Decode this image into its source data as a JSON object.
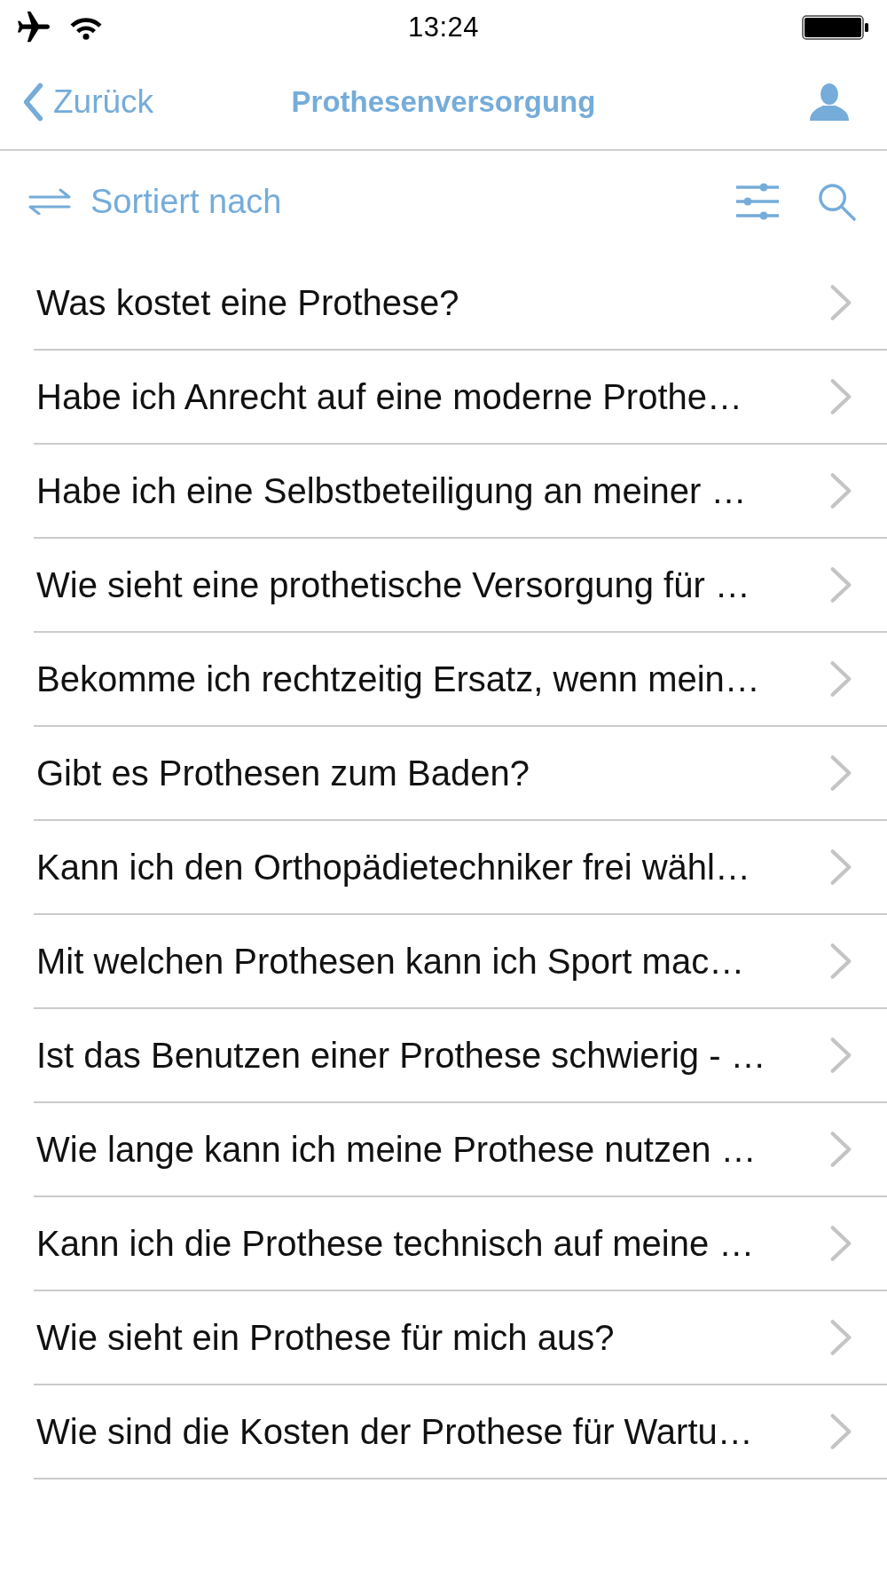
{
  "status_bar": {
    "time": "13:24"
  },
  "nav_bar": {
    "back": "Zurück",
    "title": "Prothesenversorgung"
  },
  "toolbar": {
    "sort_label": "Sortiert nach"
  },
  "questions": [
    {
      "text": "Was kostet eine Prothese?"
    },
    {
      "text": "Habe ich Anrecht auf eine moderne Prothe…"
    },
    {
      "text": "Habe ich eine Selbstbeteiligung an meiner …"
    },
    {
      "text": "Wie sieht eine prothetische Versorgung für …"
    },
    {
      "text": "Bekomme ich rechtzeitig Ersatz, wenn mein…"
    },
    {
      "text": "Gibt es Prothesen zum Baden?"
    },
    {
      "text": "Kann ich den Orthopädietechniker frei wähl…"
    },
    {
      "text": "Mit welchen Prothesen kann ich Sport mac…"
    },
    {
      "text": "Ist das Benutzen einer Prothese schwierig - …"
    },
    {
      "text": "Wie lange kann ich meine Prothese nutzen …"
    },
    {
      "text": "Kann ich die Prothese technisch auf meine …"
    },
    {
      "text": "Wie sieht ein Prothese für mich aus?"
    },
    {
      "text": "Wie sind die Kosten der Prothese für Wartu…"
    }
  ]
}
